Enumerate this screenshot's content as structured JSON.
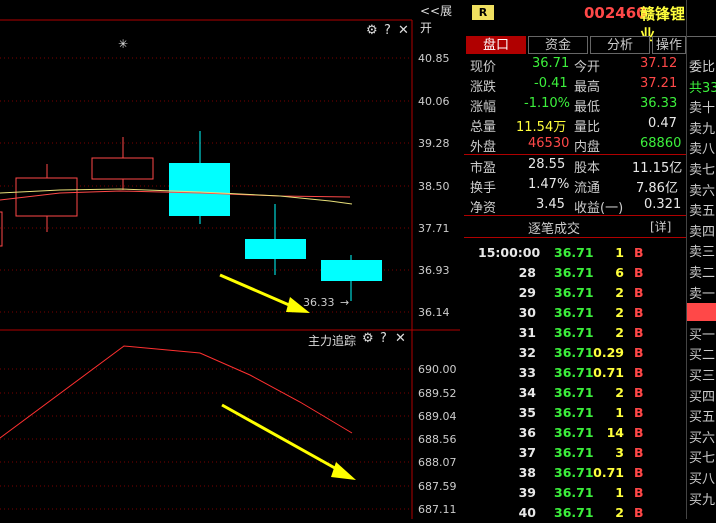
{
  "top": {
    "expand_label": "<<展开"
  },
  "kline": {
    "y_ticks": [
      "40.85",
      "40.06",
      "39.28",
      "38.50",
      "37.71",
      "36.93",
      "36.14"
    ],
    "low_marker": "36.33"
  },
  "indicator": {
    "title": "主力追踪",
    "y_ticks": [
      "690.00",
      "689.52",
      "689.04",
      "688.56",
      "688.07",
      "687.59",
      "687.11"
    ]
  },
  "stock": {
    "badge": "R",
    "code": "002460",
    "name": "赣锋锂业"
  },
  "tabs": [
    {
      "label": "盘口"
    },
    {
      "label": "资金"
    },
    {
      "label": "分析"
    },
    {
      "label": "操作"
    }
  ],
  "quote": {
    "now_label": "现价",
    "now": "36.71",
    "open_label": "今开",
    "open": "37.12",
    "chg_label": "涨跌",
    "chg": "-0.41",
    "high_label": "最高",
    "high": "37.21",
    "pct_label": "涨幅",
    "pct": "-1.10%",
    "low_label": "最低",
    "low": "36.33",
    "vol_label": "总量",
    "vol": "11.54万",
    "ratio_label": "量比",
    "ratio": "0.47",
    "outer_label": "外盘",
    "outer": "46530",
    "inner_label": "内盘",
    "inner": "68860",
    "pe_label": "市盈",
    "pe": "28.55",
    "cap_label": "股本",
    "cap": "11.15亿",
    "turn_label": "换手",
    "turn": "1.47%",
    "float_label": "流通",
    "float": "7.86亿",
    "nav_label": "净资",
    "nav": "3.45",
    "eps_label": "收益(一)",
    "eps": "0.321"
  },
  "trades": {
    "header": "逐笔成交",
    "detail": "[详]",
    "rows": [
      {
        "time": "15:00:00",
        "price": "36.71",
        "vol": "1",
        "side": "B"
      },
      {
        "time": "28",
        "price": "36.71",
        "vol": "6",
        "side": "B"
      },
      {
        "time": "29",
        "price": "36.71",
        "vol": "2",
        "side": "B"
      },
      {
        "time": "30",
        "price": "36.71",
        "vol": "2",
        "side": "B"
      },
      {
        "time": "31",
        "price": "36.71",
        "vol": "2",
        "side": "B"
      },
      {
        "time": "32",
        "price": "36.71",
        "vol": "0.29",
        "side": "B"
      },
      {
        "time": "33",
        "price": "36.71",
        "vol": "0.71",
        "side": "B"
      },
      {
        "time": "34",
        "price": "36.71",
        "vol": "2",
        "side": "B"
      },
      {
        "time": "35",
        "price": "36.71",
        "vol": "1",
        "side": "B"
      },
      {
        "time": "36",
        "price": "36.71",
        "vol": "14",
        "side": "B"
      },
      {
        "time": "37",
        "price": "36.71",
        "vol": "3",
        "side": "B"
      },
      {
        "time": "38",
        "price": "36.71",
        "vol": "0.71",
        "side": "B"
      },
      {
        "time": "39",
        "price": "36.71",
        "vol": "1",
        "side": "B"
      },
      {
        "time": "40",
        "price": "36.71",
        "vol": "2",
        "side": "B"
      }
    ]
  },
  "side": {
    "items": [
      "委比",
      "共33",
      "卖十",
      "卖九",
      "卖八",
      "卖七",
      "卖六",
      "卖五",
      "卖四",
      "卖三",
      "卖二",
      "卖一",
      "",
      "买一",
      "买二",
      "买三",
      "买四",
      "买五",
      "买六",
      "买七",
      "买八",
      "买九"
    ]
  },
  "colors": {
    "up": "#ff4848",
    "down": "#3cf03c",
    "cyan": "#00ffff",
    "yellow_arrow": "#ffff00"
  }
}
